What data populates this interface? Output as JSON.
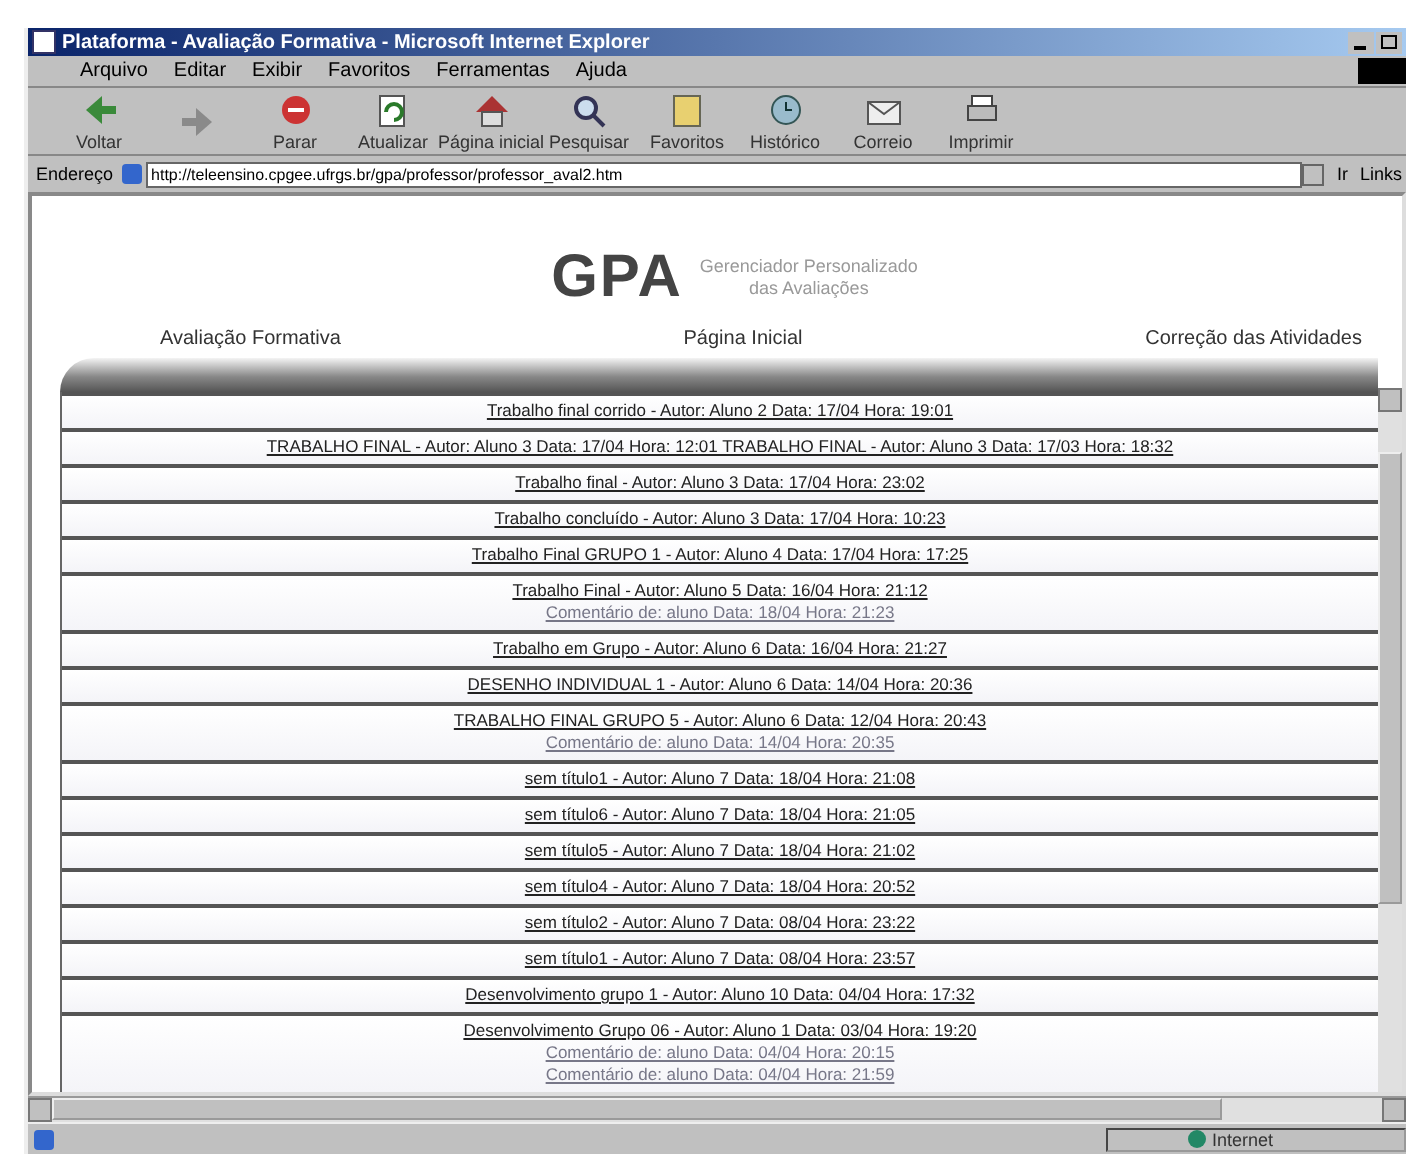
{
  "window": {
    "title": "Plataforma - Avaliação Formativa - Microsoft Internet Explorer"
  },
  "menu": [
    "Arquivo",
    "Editar",
    "Exibir",
    "Favoritos",
    "Ferramentas",
    "Ajuda"
  ],
  "toolbar": [
    {
      "label": "Voltar",
      "kind": "back"
    },
    {
      "kind": "forward"
    },
    {
      "label": "Parar",
      "kind": "stop"
    },
    {
      "label": "Atualizar",
      "kind": "refresh"
    },
    {
      "label": "Página inicial",
      "kind": "home"
    },
    {
      "label": "Pesquisar",
      "kind": "search"
    },
    {
      "label": "Favoritos",
      "kind": "favorites"
    },
    {
      "label": "Histórico",
      "kind": "history"
    },
    {
      "label": "Correio",
      "kind": "mail"
    },
    {
      "label": "Imprimir",
      "kind": "print"
    }
  ],
  "address_bar": {
    "label": "Endereço",
    "value": "http://teleensino.cpgee.ufrgs.br/gpa/professor/professor_aval2.htm",
    "go": "Ir",
    "links": "Links"
  },
  "header": {
    "logo": "GPA",
    "subtitle": "Gerenciador Personalizado das Avaliações",
    "nav": [
      "Avaliação Formativa",
      "Página Inicial",
      "Correção das Atividades"
    ]
  },
  "posts": [
    {
      "text": "Trabalho final corrido - Autor: Aluno 2 Data: 17/04 Hora: 19:01"
    },
    {
      "text": "TRABALHO FINAL - Autor: Aluno 3 Data: 17/04 Hora: 12:01 TRABALHO FINAL - Autor: Aluno 3 Data: 17/03 Hora: 18:32"
    },
    {
      "text": "Trabalho final - Autor: Aluno 3 Data: 17/04 Hora: 23:02"
    },
    {
      "text": "Trabalho concluído - Autor: Aluno 3 Data: 17/04 Hora: 10:23"
    },
    {
      "text": "Trabalho Final GRUPO 1 - Autor: Aluno 4 Data: 17/04 Hora: 17:25"
    },
    {
      "text": "Trabalho Final - Autor: Aluno 5 Data: 16/04 Hora: 21:12",
      "comments": [
        "Comentário de: aluno Data: 18/04 Hora: 21:23"
      ]
    },
    {
      "text": "Trabalho em Grupo - Autor: Aluno 6 Data: 16/04 Hora: 21:27"
    },
    {
      "text": "DESENHO INDIVIDUAL 1 - Autor: Aluno 6 Data: 14/04 Hora: 20:36"
    },
    {
      "text": "TRABALHO FINAL GRUPO 5 - Autor: Aluno 6 Data: 12/04 Hora: 20:43",
      "comments": [
        "Comentário de: aluno Data: 14/04 Hora: 20:35"
      ]
    },
    {
      "text": "sem título1 - Autor: Aluno 7 Data: 18/04 Hora: 21:08"
    },
    {
      "text": "sem título6 - Autor: Aluno 7 Data: 18/04 Hora: 21:05"
    },
    {
      "text": "sem título5 - Autor: Aluno 7 Data: 18/04 Hora: 21:02"
    },
    {
      "text": "sem título4 - Autor: Aluno 7 Data: 18/04 Hora: 20:52"
    },
    {
      "text": "sem título2 - Autor: Aluno 7 Data: 08/04 Hora: 23:22"
    },
    {
      "text": "sem título1 - Autor: Aluno 7 Data: 08/04 Hora: 23:57"
    },
    {
      "text": "Desenvolvimento grupo 1 - Autor: Aluno 10 Data: 04/04 Hora: 17:32"
    },
    {
      "text": "Desenvolvimento Grupo 06 - Autor: Aluno 1 Data: 03/04 Hora: 19:20",
      "comments": [
        "Comentário de: aluno Data: 04/04 Hora: 20:15",
        "Comentário de: aluno Data: 04/04 Hora: 21:59"
      ]
    }
  ],
  "status_bar": {
    "zone": "Internet"
  }
}
